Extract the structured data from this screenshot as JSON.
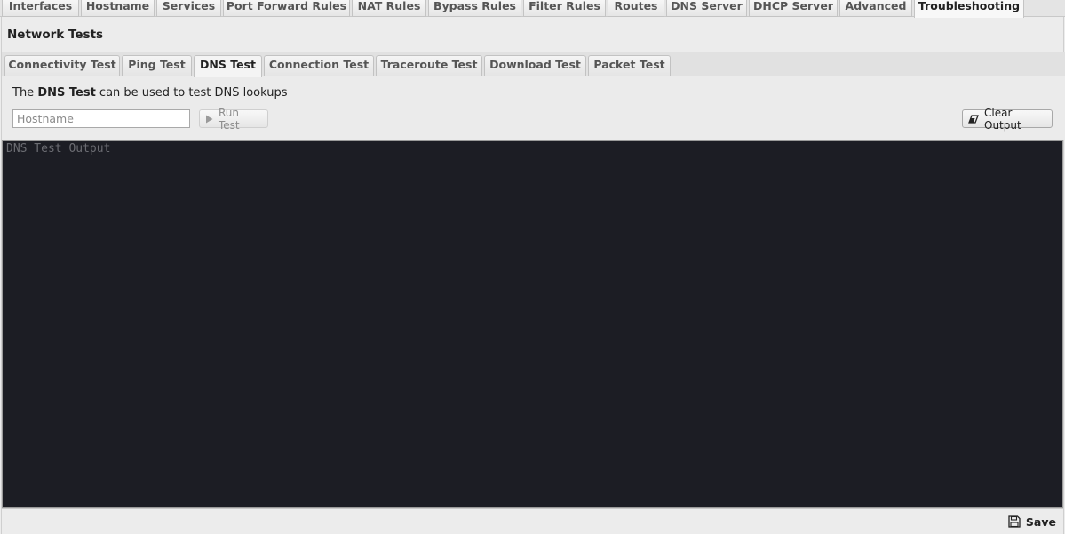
{
  "top_tabs": [
    {
      "label": "Interfaces"
    },
    {
      "label": "Hostname"
    },
    {
      "label": "Services"
    },
    {
      "label": "Port Forward Rules"
    },
    {
      "label": "NAT Rules"
    },
    {
      "label": "Bypass Rules"
    },
    {
      "label": "Filter Rules"
    },
    {
      "label": "Routes"
    },
    {
      "label": "DNS Server"
    },
    {
      "label": "DHCP Server"
    },
    {
      "label": "Advanced"
    },
    {
      "label": "Troubleshooting",
      "active": true
    }
  ],
  "section": {
    "title": "Network Tests"
  },
  "sub_tabs": [
    {
      "label": "Connectivity Test"
    },
    {
      "label": "Ping Test"
    },
    {
      "label": "DNS Test",
      "active": true
    },
    {
      "label": "Connection Test"
    },
    {
      "label": "Traceroute Test"
    },
    {
      "label": "Download Test"
    },
    {
      "label": "Packet Test"
    }
  ],
  "test": {
    "desc_prefix": "The ",
    "desc_bold": "DNS Test",
    "desc_suffix": " can be used to test DNS lookups",
    "hostname_placeholder": "Hostname",
    "hostname_value": "",
    "run_label": "Run Test",
    "clear_label": "Clear Output",
    "output_placeholder": "DNS Test Output"
  },
  "footer": {
    "save_label": "Save"
  },
  "icons": {
    "run": "play-icon",
    "clear": "eraser-icon",
    "save": "floppy-disk-icon"
  }
}
